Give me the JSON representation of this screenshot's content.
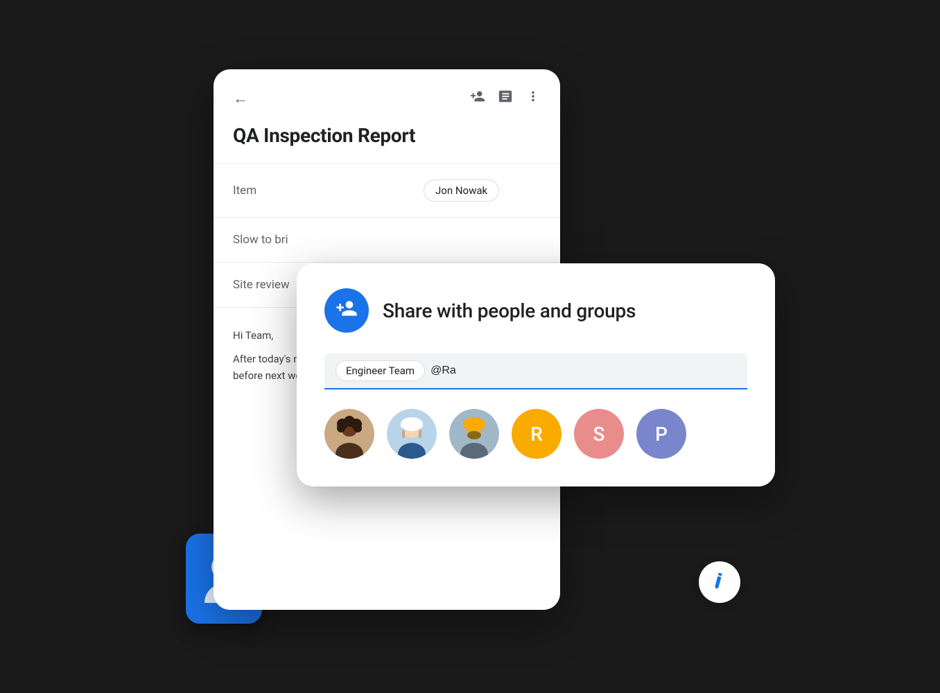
{
  "scene": {
    "doc_card": {
      "back_icon": "←",
      "header_icons": [
        "person-add",
        "notes",
        "more-vert"
      ],
      "title": "QA Inspection Report",
      "table_rows": [
        {
          "label": "Item",
          "value": "Jon Nowak"
        },
        {
          "label": "Slow to bri",
          "value": ""
        },
        {
          "label": "Site review",
          "value": ""
        }
      ],
      "body_lines": [
        "Hi Team,",
        "After today's meeting, please add your notes to the working doc before next week."
      ]
    },
    "edit_fab": {
      "icon": "✏"
    },
    "share_dialog": {
      "icon_label": "person-add",
      "title": "Share with people and groups",
      "engineer_tag": "Engineer Team",
      "input_text": "@Ra",
      "input_placeholder": "@Ra",
      "avatars": [
        {
          "type": "photo",
          "id": "1",
          "label": "Person 1"
        },
        {
          "type": "photo",
          "id": "2",
          "label": "Person 2"
        },
        {
          "type": "photo",
          "id": "3",
          "label": "Person 3"
        },
        {
          "type": "letter",
          "letter": "R",
          "color_class": "avatar-r",
          "label": "R person"
        },
        {
          "type": "letter",
          "letter": "S",
          "color_class": "avatar-s",
          "label": "S person"
        },
        {
          "type": "letter",
          "letter": "P",
          "color_class": "avatar-p",
          "label": "P person"
        }
      ]
    },
    "blue_card": {
      "label": "User card"
    }
  }
}
